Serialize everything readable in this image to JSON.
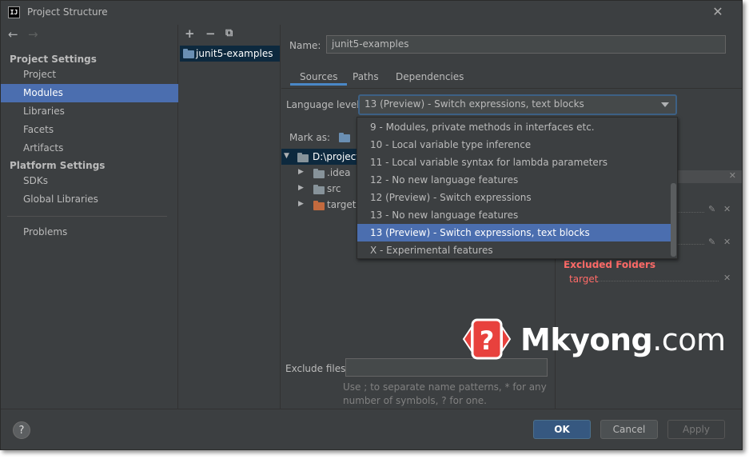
{
  "window": {
    "title": "Project Structure",
    "app_icon_text": "IJ"
  },
  "left_nav": {
    "back_icon": "arrow-left-icon",
    "forward_icon": "arrow-right-icon",
    "sections": [
      {
        "title": "Project Settings",
        "items": [
          "Project",
          "Modules",
          "Libraries",
          "Facets",
          "Artifacts"
        ]
      },
      {
        "title": "Platform Settings",
        "items": [
          "SDKs",
          "Global Libraries"
        ]
      }
    ],
    "bottom_item": "Problems",
    "selected": "Modules"
  },
  "modules_pane": {
    "tools": [
      "+",
      "−",
      "⧉"
    ],
    "module_name": "junit5-examples"
  },
  "module_settings": {
    "name_label": "Name:",
    "name_value": "junit5-examples",
    "tabs": [
      "Sources",
      "Paths",
      "Dependencies"
    ],
    "active_tab": "Sources",
    "language_level_label": "Language level:",
    "language_level_value": "13 (Preview) - Switch expressions, text blocks",
    "mark_as_label": "Mark as:",
    "tree": {
      "root": "D:\\projects",
      "children": [
        ".idea",
        "src",
        "target"
      ]
    },
    "excluded_title": "Excluded Folders",
    "excluded_items": [
      "target"
    ],
    "exclude_files_label": "Exclude files:",
    "exclude_files_value": "",
    "exclude_hint_line1": "Use ; to separate name patterns, * for any",
    "exclude_hint_line2": "number of symbols, ? for one."
  },
  "language_dropdown": {
    "options": [
      "9 - Modules, private methods in interfaces etc.",
      "10 - Local variable type inference",
      "11 - Local variable syntax for lambda parameters",
      "12 - No new language features",
      "12 (Preview) - Switch expressions",
      "13 - No new language features",
      "13 (Preview) - Switch expressions, text blocks",
      "X - Experimental features"
    ],
    "selected_index": 6
  },
  "footer": {
    "help": "?",
    "ok": "OK",
    "cancel": "Cancel",
    "apply": "Apply"
  },
  "watermark": {
    "brand": "Mkyong",
    "suffix": ".com",
    "badge_glyph": "?",
    "colors": {
      "badge": "#e8413d",
      "badge_outline": "#ffffff"
    }
  }
}
